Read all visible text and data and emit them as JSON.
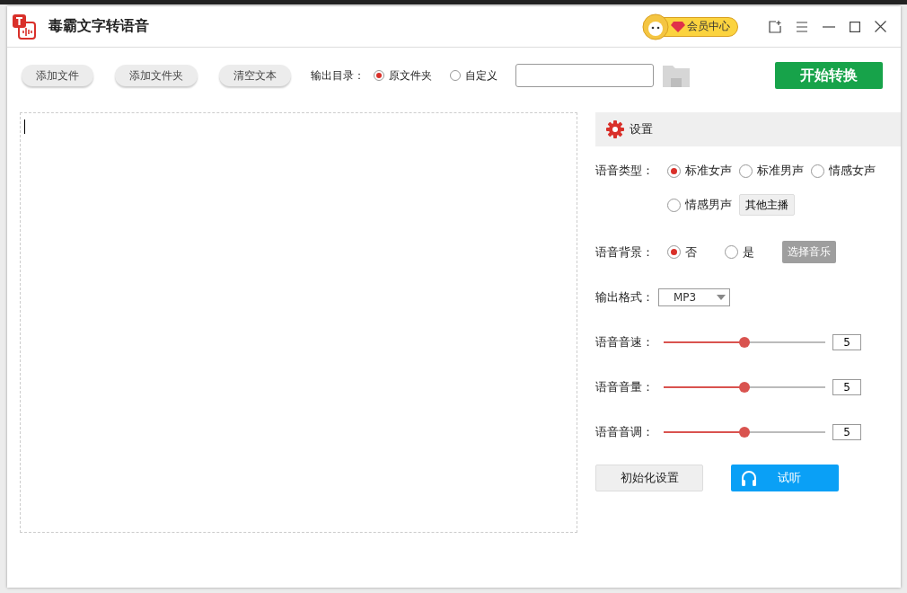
{
  "window": {
    "title": "毒霸文字转语音"
  },
  "vip_button": {
    "label": "会员中心"
  },
  "toolbar": {
    "buttons": [
      "添加文件",
      "添加文件夹",
      "清空文本"
    ],
    "output_dir_label": "输出目录：",
    "output_options": [
      {
        "label": "原文件夹",
        "selected": true
      },
      {
        "label": "自定义",
        "selected": false
      }
    ],
    "start_button": "开始转换"
  },
  "settings": {
    "title": "设置",
    "voice_type": {
      "label": "语音类型：",
      "options": [
        {
          "label": "标准女声",
          "selected": true
        },
        {
          "label": "标准男声",
          "selected": false
        },
        {
          "label": "情感女声",
          "selected": false
        },
        {
          "label": "情感男声",
          "selected": false
        }
      ],
      "more_button": "其他主播"
    },
    "background": {
      "label": "语音背景：",
      "options": [
        {
          "label": "否",
          "selected": true
        },
        {
          "label": "是",
          "selected": false
        }
      ],
      "choose_music_button": {
        "label": "选择音乐",
        "disabled": true
      }
    },
    "format": {
      "label": "输出格式：",
      "value": "MP3"
    },
    "sliders": [
      {
        "label": "语音音速：",
        "level": 0.5,
        "value": "5"
      },
      {
        "label": "语音音量：",
        "level": 0.5,
        "value": "5"
      },
      {
        "label": "语音音调：",
        "level": 0.5,
        "value": "5"
      }
    ],
    "reset_button": "初始化设置",
    "preview_button": "试听"
  }
}
